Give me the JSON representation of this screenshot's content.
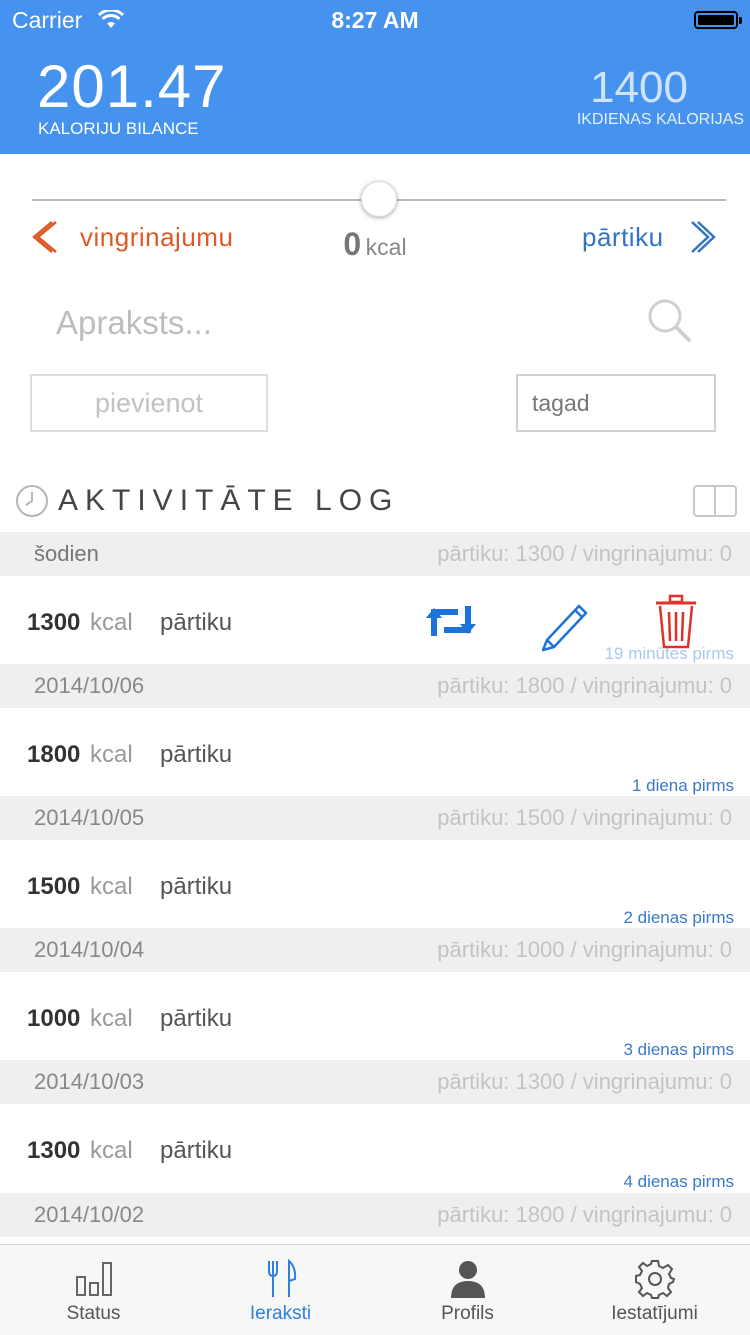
{
  "status_bar": {
    "carrier": "Carrier",
    "time": "8:27 AM"
  },
  "header": {
    "balance_value": "201.47",
    "balance_label": "KALORIJU BILANCE",
    "daily_value": "1400",
    "daily_label": "IKDIENAS KALORIJAS"
  },
  "slider": {
    "left_label": "vingrinajumu",
    "right_label": "pārtiku",
    "value": "0",
    "unit": "kcal",
    "position_fraction": 0.5
  },
  "form": {
    "description_placeholder": "Apraksts...",
    "add_button": "pievienot",
    "time_value": "tagad"
  },
  "log": {
    "title": "AKTIVITĀTE LOG",
    "kcal_unit": "kcal",
    "groups": [
      {
        "date": "šodien",
        "summary": "pārtiku: 1300 / vingrinajumu: 0",
        "entry": {
          "kcal": "1300",
          "type": "pārtiku",
          "ago": "19 minūtes pirms"
        }
      },
      {
        "date": "2014/10/06",
        "summary": "pārtiku: 1800 / vingrinajumu: 0",
        "entry": {
          "kcal": "1800",
          "type": "pārtiku",
          "ago": "1 diena pirms"
        }
      },
      {
        "date": "2014/10/05",
        "summary": "pārtiku: 1500 / vingrinajumu: 0",
        "entry": {
          "kcal": "1500",
          "type": "pārtiku",
          "ago": "2 dienas pirms"
        }
      },
      {
        "date": "2014/10/04",
        "summary": "pārtiku: 1000 / vingrinajumu: 0",
        "entry": {
          "kcal": "1000",
          "type": "pārtiku",
          "ago": "3 dienas pirms"
        }
      },
      {
        "date": "2014/10/03",
        "summary": "pārtiku: 1300 / vingrinajumu: 0",
        "entry": {
          "kcal": "1300",
          "type": "pārtiku",
          "ago": "4 dienas pirms"
        }
      },
      {
        "date": "2014/10/02",
        "summary": "pārtiku: 1800 / vingrinajumu: 0"
      }
    ]
  },
  "tabs": [
    {
      "label": "Status",
      "icon": "bar-chart-icon"
    },
    {
      "label": "Ieraksti",
      "icon": "fork-knife-icon",
      "active": true
    },
    {
      "label": "Profils",
      "icon": "person-icon"
    },
    {
      "label": "Iestatījumi",
      "icon": "gear-icon"
    }
  ],
  "colors": {
    "header": "#4593ef",
    "exercise": "#dd5a26",
    "food": "#3373c6",
    "delete": "#e0302a",
    "active_tab": "#2d7fe0"
  }
}
